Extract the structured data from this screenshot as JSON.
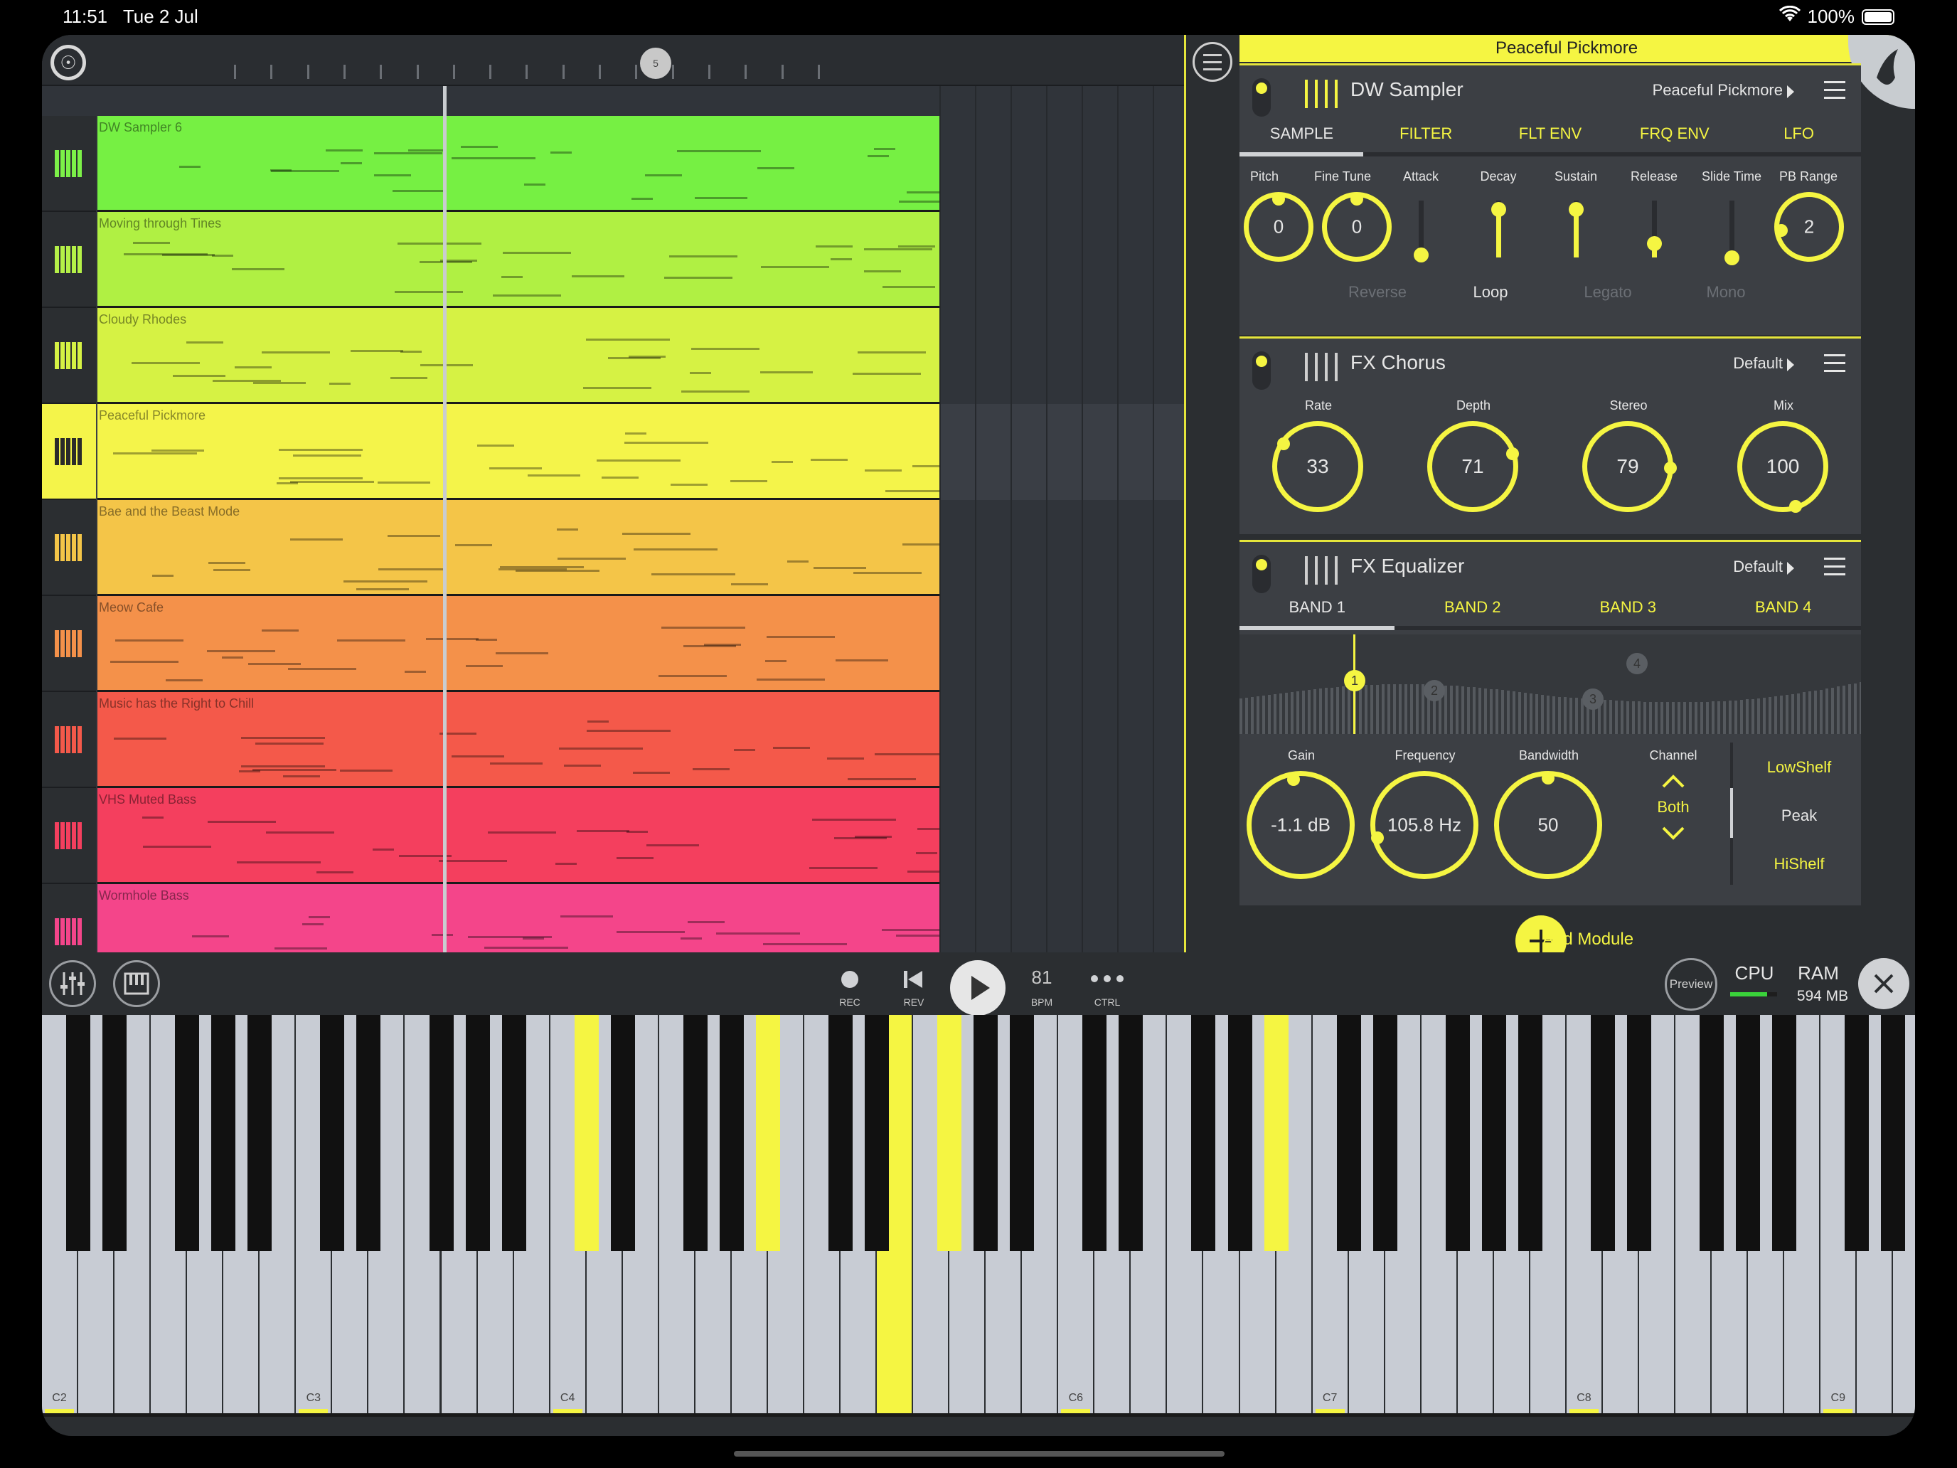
{
  "status": {
    "time": "11:51",
    "date": "Tue 2 Jul",
    "battery": "100%"
  },
  "playlist": {
    "marker": "5",
    "tracks": [
      {
        "name": "DW Sampler 6",
        "color": "#76f043",
        "icon": "#7cf048"
      },
      {
        "name": "Moving through Tines",
        "color": "#b0f043",
        "icon": "#b5f048"
      },
      {
        "name": "Cloudy Rhodes",
        "color": "#d6f244",
        "icon": "#d6f244"
      },
      {
        "name": "Peaceful Pickmore",
        "color": "#f4f44a",
        "icon": "#2a2a2a"
      },
      {
        "name": "Bae and the Beast Mode",
        "color": "#f4c548",
        "icon": "#f4c548"
      },
      {
        "name": "Meow Cafe",
        "color": "#f4914a",
        "icon": "#f4914a"
      },
      {
        "name": "Music has the Right to Chill",
        "color": "#f4594a",
        "icon": "#f4594a"
      },
      {
        "name": "VHS Muted Bass",
        "color": "#f43f5e",
        "icon": "#f43f5e"
      },
      {
        "name": "Wormhole Bass",
        "color": "#f4458a",
        "icon": "#f4458a"
      }
    ]
  },
  "channel_title": "Peaceful Pickmore",
  "sampler": {
    "title": "DW Sampler",
    "preset": "Peaceful Pickmore",
    "tabs": [
      "SAMPLE",
      "FILTER",
      "FLT ENV",
      "FRQ ENV",
      "LFO"
    ],
    "params": {
      "pitch": {
        "label": "Pitch",
        "value": "0"
      },
      "finetune": {
        "label": "Fine Tune",
        "value": "0"
      },
      "attack": {
        "label": "Attack",
        "level": 0.05
      },
      "decay": {
        "label": "Decay",
        "level": 0.85
      },
      "sustain": {
        "label": "Sustain",
        "level": 0.85
      },
      "release": {
        "label": "Release",
        "level": 0.25
      },
      "slide": {
        "label": "Slide Time",
        "level": 0.0
      },
      "pbrange": {
        "label": "PB Range",
        "value": "2"
      }
    },
    "toggles": {
      "reverse": "Reverse",
      "loop": "Loop",
      "legato": "Legato",
      "mono": "Mono"
    }
  },
  "chorus": {
    "title": "FX Chorus",
    "preset": "Default",
    "params": {
      "rate": {
        "label": "Rate",
        "value": "33"
      },
      "depth": {
        "label": "Depth",
        "value": "71"
      },
      "stereo": {
        "label": "Stereo",
        "value": "79"
      },
      "mix": {
        "label": "Mix",
        "value": "100"
      }
    }
  },
  "equalizer": {
    "title": "FX Equalizer",
    "preset": "Default",
    "tabs": [
      "BAND 1",
      "BAND 2",
      "BAND 3",
      "BAND 4"
    ],
    "bands": [
      "1",
      "2",
      "3",
      "4"
    ],
    "params": {
      "gain": {
        "label": "Gain",
        "value": "-1.1 dB"
      },
      "frequency": {
        "label": "Frequency",
        "value": "105.8 Hz"
      },
      "bandwidth": {
        "label": "Bandwidth",
        "value": "50"
      },
      "channel": {
        "label": "Channel",
        "value": "Both"
      }
    },
    "filter_types": [
      "LowShelf",
      "Peak",
      "HiShelf"
    ]
  },
  "add_module": "Add Module",
  "transport": {
    "rec": "REC",
    "rev": "REV",
    "bpm_value": "81",
    "bpm": "BPM",
    "ctrl": "CTRL",
    "preview": "Preview",
    "cpu": "CPU",
    "ram": "RAM",
    "ram_value": "594 MB"
  },
  "keyboard": {
    "octave_labels": [
      "C2",
      "C3",
      "C4",
      "C6",
      "C7",
      "C8",
      "C9"
    ]
  }
}
